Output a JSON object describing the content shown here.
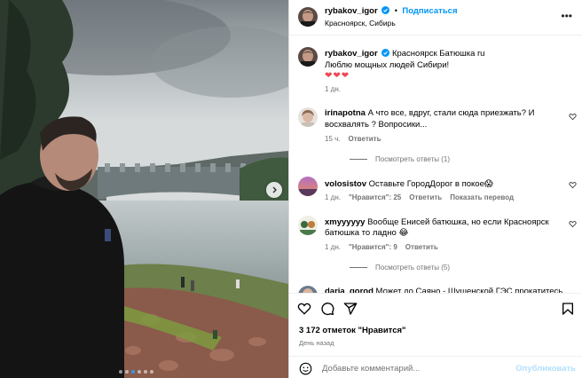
{
  "post": {
    "author": "rybakov_igor",
    "follow_label": "Подписаться",
    "location": "Красноярск, Сибирь",
    "more_glyph": "•••"
  },
  "caption": {
    "author": "rybakov_igor",
    "line1": "Красноярск Батюшка ru",
    "line2": "Люблю мощных людей Сибири!",
    "hearts": "❤❤❤",
    "time": "1 дн."
  },
  "comments": [
    {
      "author": "irinapotna",
      "line1": "А что все, вдруг, стали сюда приезжать? И",
      "line2": "восхвалять ? Вопросики...",
      "time": "15 ч.",
      "likes": "",
      "reply_label": "Ответить",
      "view_replies": "Посмотреть ответы (1)"
    },
    {
      "author": "volosistov",
      "line1": "Оставьте ГородДорог в покое😱",
      "line2": "",
      "time": "1 дн.",
      "likes": "\"Нравится\": 25",
      "reply_label": "Ответить",
      "translate_label": "Показать перевод"
    },
    {
      "author": "xmyyyyyy",
      "line1": "Вообще Енисей батюшка, но если Красноярск",
      "line2": "батюшка то ладно 😂",
      "time": "1 дн.",
      "likes": "\"Нравится\": 9",
      "reply_label": "Ответить",
      "view_replies": "Посмотреть ответы (5)"
    },
    {
      "author": "daria_gorod",
      "line1": "Может до Саяно - Шушенской ГЭС прокатитесь",
      "line2": ""
    }
  ],
  "footer": {
    "likes_count": "3 172 отметок \"Нравится\"",
    "date": "День назад",
    "comment_placeholder": "Добавьте комментарий...",
    "publish_label": "Опубликовать"
  },
  "carousel": {
    "slides": 6,
    "active_index": 2
  },
  "colors": {
    "accent": "#0095f6",
    "verified": "#0095f6",
    "hearts": "#ed4956",
    "muted": "#737373"
  },
  "icons": [
    "verified-badge-icon",
    "more-options-icon",
    "heart-icon",
    "comment-icon",
    "share-icon",
    "bookmark-icon",
    "emoji-icon",
    "chevron-right-icon"
  ]
}
